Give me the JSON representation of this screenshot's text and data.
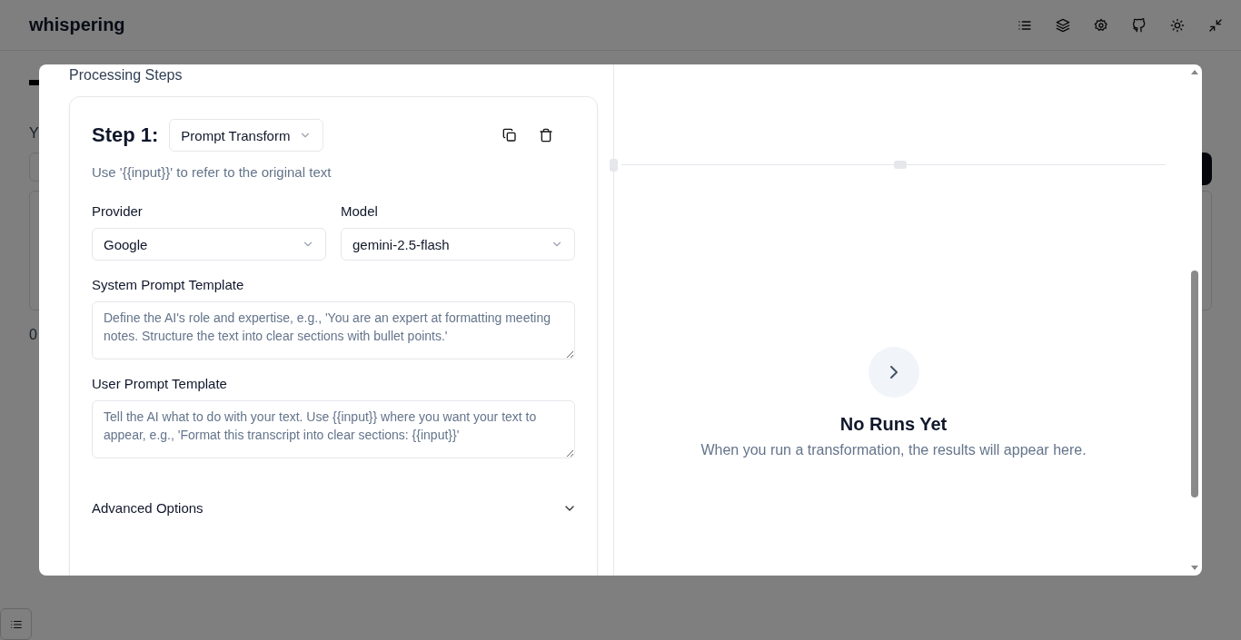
{
  "app": {
    "title": "whispering"
  },
  "background": {
    "texts": [
      "Y",
      "0"
    ]
  },
  "dialog": {
    "section_title": "Processing Steps",
    "step": {
      "label": "Step 1:",
      "type": "Prompt Transform",
      "hint": "Use '{{input}}' to refer to the original text",
      "fields": [
        {
          "kind": "select",
          "label": "Provider",
          "value": "Google"
        },
        {
          "kind": "select",
          "label": "Model",
          "value": "gemini-2.5-flash"
        },
        {
          "kind": "textarea",
          "label": "System Prompt Template",
          "placeholder": "Define the AI's role and expertise, e.g., 'You are an expert at formatting meeting notes. Structure the text into clear sections with bullet points.'"
        },
        {
          "kind": "textarea",
          "label": "User Prompt Template",
          "placeholder": "Tell the AI what to do with your text. Use {{input}} where you want your text to appear, e.g., 'Format this transcript into clear sections: {{input}}'"
        }
      ],
      "advanced": {
        "label": "Advanced Options",
        "expanded": false
      }
    },
    "results": {
      "title": "No Runs Yet",
      "message": "When you run a transformation, the results will appear here."
    }
  }
}
